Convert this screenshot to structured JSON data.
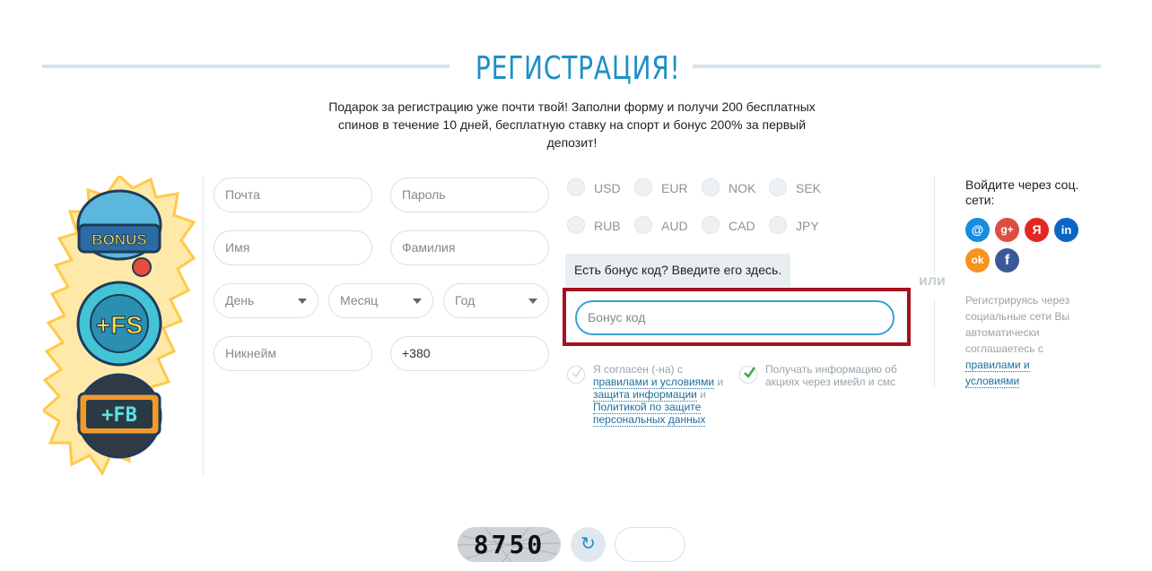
{
  "header": {
    "title": "РЕГИСТРАЦИЯ!",
    "subtitle": "Подарок за регистрацию уже почти твой! Заполни форму и получи 200 бесплатных спинов в течение 10 дней, бесплатную ставку на спорт и бонус 200% за первый депозит!"
  },
  "illustration": {
    "bonus_label": "BONUS",
    "fs_label": "+FS",
    "fb_label": "+FB"
  },
  "form": {
    "email_placeholder": "Почта",
    "password_placeholder": "Пароль",
    "first_name_placeholder": "Имя",
    "last_name_placeholder": "Фамилия",
    "day_label": "День",
    "month_label": "Месяц",
    "year_label": "Год",
    "nickname_placeholder": "Никнейм",
    "phone_value": "+380"
  },
  "currencies": [
    "USD",
    "EUR",
    "NOK",
    "SEK",
    "RUB",
    "AUD",
    "CAD",
    "JPY"
  ],
  "bonus": {
    "tooltip": "Есть бонус код? Введите его здесь.",
    "placeholder": "Бонус код"
  },
  "or_label": "или",
  "agreement": {
    "prefix": "Я согласен (-на) с ",
    "terms_link": "правилами и условиями",
    "and1": " и ",
    "privacy_link": "защита информации",
    "and2": " и ",
    "policy_link": "Политикой по защите персональных данных"
  },
  "newsletter": "Получать информацию об акциях через имейл и смс",
  "social": {
    "title": "Войдите через соц. сети:",
    "icons": [
      {
        "name": "mail-ru-icon",
        "glyph": "@",
        "color": "#168de2"
      },
      {
        "name": "google-plus-icon",
        "glyph": "g+",
        "color": "#dc4e41"
      },
      {
        "name": "yandex-icon",
        "glyph": "Я",
        "color": "#e52620"
      },
      {
        "name": "linkedin-icon",
        "glyph": "in",
        "color": "#0a66c2"
      },
      {
        "name": "odnoklassniki-icon",
        "glyph": "ok",
        "color": "#f7931e"
      },
      {
        "name": "facebook-icon",
        "glyph": "f",
        "color": "#3b5998"
      }
    ],
    "note_prefix": "Регистрируясь через социальные сети Вы автоматически соглашаетесь с ",
    "note_link": "правилами и условиями"
  },
  "captcha": {
    "code": "8750",
    "refresh_glyph": "↻"
  }
}
